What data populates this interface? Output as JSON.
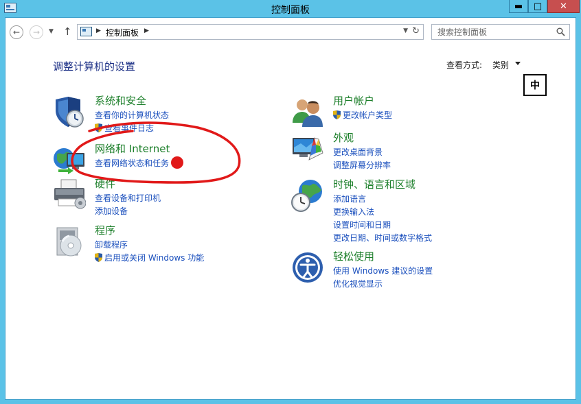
{
  "window": {
    "title": "控制面板",
    "minimize_label": "▬",
    "maximize_label": "□",
    "close_label": "✕"
  },
  "address_bar": {
    "path": "控制面板",
    "refresh_glyph": "↻"
  },
  "search": {
    "placeholder": "搜索控制面板"
  },
  "content": {
    "heading": "调整计算机的设置",
    "view_by_label": "查看方式:",
    "view_by_value": "类别"
  },
  "ime_indicator": "中",
  "categories_left": [
    {
      "icon": "security-shield-icon",
      "title": "系统和安全",
      "links": [
        "查看你的计算机状态",
        "查看事件日志"
      ]
    },
    {
      "icon": "network-globe-icon",
      "title": "网络和 Internet",
      "links": [
        "查看网络状态和任务"
      ]
    },
    {
      "icon": "printer-icon",
      "title": "硬件",
      "links": [
        "查看设备和打印机",
        "添加设备"
      ]
    },
    {
      "icon": "programs-icon",
      "title": "程序",
      "links": [
        "卸载程序",
        "启用或关闭 Windows 功能"
      ]
    }
  ],
  "categories_right": [
    {
      "icon": "users-icon",
      "title": "用户帐户",
      "links": [
        "更改帐户类型"
      ]
    },
    {
      "icon": "appearance-icon",
      "title": "外观",
      "links": [
        "更改桌面背景",
        "调整屏幕分辨率"
      ]
    },
    {
      "icon": "clock-globe-icon",
      "title": "时钟、语言和区域",
      "links": [
        "添加语言",
        "更换输入法",
        "设置时间和日期",
        "更改日期、时间或数字格式"
      ]
    },
    {
      "icon": "ease-of-access-icon",
      "title": "轻松使用",
      "links": [
        "使用 Windows 建议的设置",
        "优化视觉显示"
      ]
    }
  ],
  "colors": {
    "titlebar": "#5bc2e7",
    "category_title": "#1c7f2a",
    "link": "#1a4fbd",
    "heading": "#1e3287",
    "annotation": "#e11919"
  }
}
